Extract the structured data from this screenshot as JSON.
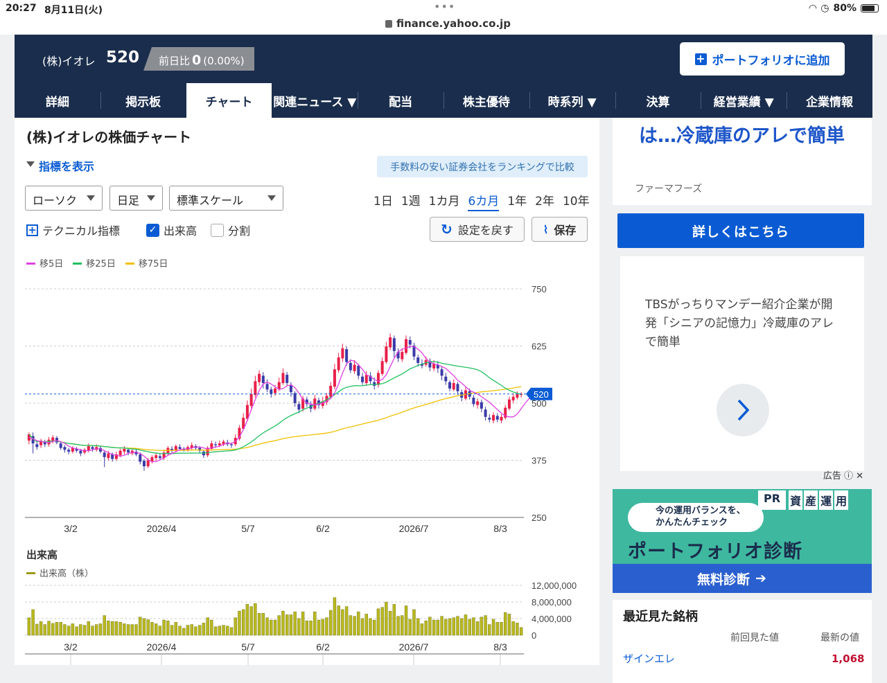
{
  "status": {
    "time": "20:27",
    "date": "8月11日(火)",
    "url": "finance.yahoo.co.jp",
    "battery": "80%"
  },
  "header": {
    "name": "(株)イオレ",
    "price": "520",
    "change_label": "前日比",
    "change_value": "0",
    "change_pct": "(0.00%)",
    "portfolio_button": "ポートフォリオに追加"
  },
  "nav": [
    "詳細",
    "掲示板",
    "チャート",
    "関連ニュース ▼",
    "配当",
    "株主優待",
    "時系列 ▼",
    "決算",
    "経営業績 ▼",
    "企業情報"
  ],
  "main": {
    "title": "(株)イオレの株価チャート",
    "indicator_toggle": "指標を表示",
    "fee_link": "手数料の安い証券会社をランキングで比較",
    "selects": {
      "type": "ローソク",
      "interval": "日足",
      "scale": "標準スケール"
    },
    "periods": [
      "1日",
      "1週",
      "1カ月",
      "6カ月",
      "1年",
      "2年",
      "10年"
    ],
    "tech_label": "テクニカル指標",
    "volume_label": "出来高",
    "split_label": "分割",
    "reset_label": "設定を戻す",
    "save_label": "保存",
    "legend": [
      "移5日",
      "移25日",
      "移75日"
    ],
    "volume_title": "出来高",
    "volume_legend": "出来高（株）"
  },
  "colors": {
    "up": "#e8204a",
    "down": "#3a3aa8",
    "ma5": "#e040e0",
    "ma25": "#20c060",
    "ma75": "#f0c000",
    "accent": "#0a5bd3",
    "navy": "#1a2d4c"
  },
  "chart_data": {
    "type": "candlestick",
    "price_axis": [
      750,
      625,
      500,
      375,
      250
    ],
    "x_labels": [
      "3/2",
      "2026/4",
      "5/7",
      "6/2",
      "2026/7",
      "8/3"
    ],
    "last_price": 520,
    "volume_axis": [
      "12,000,000",
      "8,000,000",
      "4,000,000",
      "0"
    ],
    "volume_max": 12000000,
    "candles": [
      [
        418,
        432,
        436,
        410
      ],
      [
        428,
        412,
        436,
        390
      ],
      [
        410,
        404,
        415,
        398
      ],
      [
        408,
        418,
        422,
        402
      ],
      [
        416,
        410,
        420,
        404
      ],
      [
        410,
        420,
        426,
        405
      ],
      [
        418,
        425,
        430,
        412
      ],
      [
        424,
        414,
        428,
        410
      ],
      [
        412,
        402,
        416,
        398
      ],
      [
        404,
        398,
        408,
        392
      ],
      [
        398,
        394,
        402,
        388
      ],
      [
        394,
        402,
        406,
        390
      ],
      [
        400,
        396,
        404,
        392
      ],
      [
        396,
        390,
        400,
        384
      ],
      [
        392,
        398,
        402,
        388
      ],
      [
        396,
        406,
        412,
        392
      ],
      [
        404,
        400,
        408,
        394
      ],
      [
        398,
        404,
        410,
        394
      ],
      [
        402,
        394,
        406,
        390
      ],
      [
        392,
        382,
        396,
        360
      ],
      [
        380,
        390,
        396,
        374
      ],
      [
        388,
        378,
        392,
        372
      ],
      [
        378,
        388,
        394,
        374
      ],
      [
        386,
        396,
        400,
        382
      ],
      [
        394,
        400,
        406,
        388
      ],
      [
        398,
        392,
        402,
        386
      ],
      [
        390,
        396,
        402,
        386
      ],
      [
        394,
        388,
        400,
        384
      ],
      [
        388,
        372,
        392,
        366
      ],
      [
        374,
        362,
        378,
        352
      ],
      [
        362,
        375,
        380,
        358
      ],
      [
        372,
        382,
        386,
        368
      ],
      [
        380,
        386,
        392,
        374
      ],
      [
        384,
        380,
        390,
        376
      ],
      [
        380,
        392,
        398,
        376
      ],
      [
        390,
        402,
        406,
        386
      ],
      [
        400,
        396,
        406,
        390
      ],
      [
        396,
        406,
        410,
        392
      ],
      [
        404,
        400,
        410,
        396
      ],
      [
        400,
        398,
        404,
        394
      ],
      [
        398,
        404,
        408,
        394
      ],
      [
        402,
        408,
        414,
        398
      ],
      [
        406,
        402,
        410,
        398
      ],
      [
        402,
        396,
        406,
        392
      ],
      [
        394,
        386,
        398,
        380
      ],
      [
        386,
        402,
        406,
        382
      ],
      [
        400,
        412,
        418,
        396
      ],
      [
        410,
        408,
        416,
        402
      ],
      [
        408,
        412,
        418,
        404
      ],
      [
        410,
        416,
        420,
        406
      ],
      [
        414,
        410,
        420,
        406
      ],
      [
        410,
        408,
        414,
        402
      ],
      [
        410,
        424,
        432,
        406
      ],
      [
        422,
        446,
        452,
        418
      ],
      [
        444,
        468,
        478,
        440
      ],
      [
        466,
        496,
        506,
        460
      ],
      [
        494,
        520,
        532,
        488
      ],
      [
        518,
        548,
        560,
        512
      ],
      [
        546,
        564,
        572,
        538
      ],
      [
        560,
        544,
        568,
        532
      ],
      [
        542,
        530,
        552,
        524
      ],
      [
        530,
        520,
        536,
        512
      ],
      [
        522,
        532,
        540,
        516
      ],
      [
        530,
        546,
        556,
        526
      ],
      [
        544,
        566,
        576,
        540
      ],
      [
        562,
        544,
        568,
        538
      ],
      [
        540,
        524,
        546,
        514
      ],
      [
        522,
        500,
        526,
        492
      ],
      [
        498,
        486,
        504,
        478
      ],
      [
        488,
        510,
        516,
        482
      ],
      [
        508,
        498,
        514,
        492
      ],
      [
        496,
        488,
        504,
        480
      ],
      [
        488,
        510,
        518,
        484
      ],
      [
        506,
        496,
        512,
        488
      ],
      [
        494,
        504,
        514,
        488
      ],
      [
        502,
        516,
        522,
        496
      ],
      [
        514,
        538,
        546,
        510
      ],
      [
        536,
        574,
        586,
        530
      ],
      [
        572,
        600,
        610,
        566
      ],
      [
        598,
        620,
        630,
        590
      ],
      [
        618,
        590,
        624,
        582
      ],
      [
        588,
        572,
        596,
        566
      ],
      [
        570,
        584,
        594,
        564
      ],
      [
        582,
        560,
        586,
        552
      ],
      [
        558,
        546,
        566,
        540
      ],
      [
        544,
        562,
        570,
        538
      ],
      [
        560,
        548,
        568,
        542
      ],
      [
        546,
        538,
        556,
        530
      ],
      [
        540,
        566,
        572,
        534
      ],
      [
        564,
        592,
        600,
        560
      ],
      [
        590,
        624,
        634,
        586
      ],
      [
        622,
        644,
        652,
        616
      ],
      [
        642,
        614,
        648,
        600
      ],
      [
        612,
        598,
        620,
        590
      ],
      [
        596,
        612,
        620,
        590
      ],
      [
        610,
        640,
        648,
        606
      ],
      [
        638,
        628,
        646,
        620
      ],
      [
        626,
        602,
        632,
        594
      ],
      [
        600,
        588,
        606,
        580
      ],
      [
        586,
        582,
        596,
        576
      ],
      [
        584,
        594,
        602,
        580
      ],
      [
        592,
        578,
        598,
        570
      ],
      [
        576,
        586,
        594,
        570
      ],
      [
        584,
        576,
        592,
        566
      ],
      [
        574,
        560,
        580,
        550
      ],
      [
        558,
        548,
        566,
        540
      ],
      [
        546,
        532,
        550,
        526
      ],
      [
        530,
        544,
        552,
        526
      ],
      [
        542,
        526,
        546,
        518
      ],
      [
        524,
        512,
        530,
        504
      ],
      [
        510,
        528,
        536,
        506
      ],
      [
        526,
        514,
        532,
        508
      ],
      [
        512,
        498,
        518,
        492
      ],
      [
        496,
        504,
        510,
        488
      ],
      [
        502,
        488,
        508,
        480
      ],
      [
        486,
        470,
        492,
        462
      ],
      [
        468,
        464,
        476,
        458
      ],
      [
        462,
        474,
        480,
        456
      ],
      [
        472,
        464,
        478,
        458
      ],
      [
        462,
        470,
        476,
        456
      ],
      [
        468,
        490,
        496,
        464
      ],
      [
        488,
        508,
        514,
        484
      ],
      [
        506,
        514,
        522,
        500
      ],
      [
        512,
        520,
        526,
        508
      ],
      [
        518,
        520,
        524,
        512
      ]
    ],
    "ma5": [
      425,
      422,
      418,
      416,
      415,
      414,
      416,
      418,
      416,
      412,
      406,
      402,
      400,
      398,
      396,
      396,
      398,
      400,
      400,
      396,
      392,
      388,
      386,
      384,
      386,
      390,
      392,
      392,
      390,
      384,
      376,
      372,
      372,
      376,
      380,
      386,
      390,
      394,
      398,
      400,
      400,
      402,
      404,
      404,
      402,
      400,
      402,
      404,
      406,
      410,
      412,
      412,
      416,
      426,
      442,
      462,
      486,
      508,
      528,
      542,
      546,
      542,
      536,
      530,
      532,
      538,
      540,
      534,
      522,
      508,
      500,
      498,
      496,
      498,
      500,
      504,
      510,
      522,
      542,
      566,
      586,
      594,
      592,
      584,
      574,
      562,
      558,
      552,
      548,
      552,
      562,
      580,
      598,
      612,
      618,
      620,
      624,
      624,
      618,
      610,
      598,
      590,
      586,
      584,
      580,
      576,
      568,
      560,
      550,
      544,
      536,
      528,
      524,
      520,
      514,
      508,
      502,
      494,
      486,
      478,
      472,
      470,
      470,
      476,
      488,
      500,
      510,
      516
    ]
  }
}
